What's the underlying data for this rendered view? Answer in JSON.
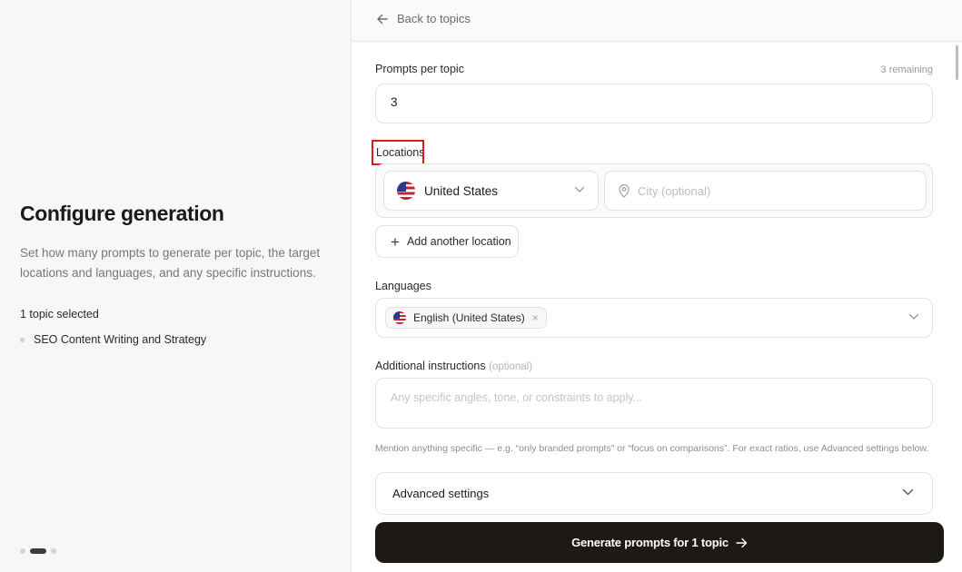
{
  "left_panel": {
    "title": "Configure generation",
    "description": "Set how many prompts to generate per topic, the target locations and languages, and any specific instructions.",
    "selected_count": "1 topic selected",
    "topics": [
      "SEO Content Writing and Strategy"
    ],
    "step_indicator": {
      "total": 3,
      "current": 2
    }
  },
  "header": {
    "back_label": "Back to topics",
    "back_icon": "arrow-left-icon"
  },
  "form": {
    "prompts_per_topic": {
      "label": "Prompts per topic",
      "remaining": "3 remaining",
      "value": "3"
    },
    "locations": {
      "label": "Locations",
      "country": "United States",
      "country_flag": "us-flag-icon",
      "city_placeholder": "City (optional)",
      "add_label": "Add another location"
    },
    "languages": {
      "label": "Languages",
      "selected": [
        "English (United States)"
      ],
      "remove_glyph": "×"
    },
    "instructions": {
      "label": "Additional instructions",
      "optional_tag": "(optional)",
      "placeholder": "Any specific angles, tone, or constraints to apply...",
      "hint": "Mention anything specific — e.g. “only branded prompts” or “focus on comparisons”. For exact ratios, use Advanced settings below."
    },
    "advanced": {
      "label": "Advanced settings"
    },
    "submit": {
      "label": "Generate prompts for 1 topic"
    }
  },
  "colors": {
    "primary_button": "#1c1917",
    "highlight_box": "#d91c1c",
    "left_bg": "#f7f7f5"
  }
}
